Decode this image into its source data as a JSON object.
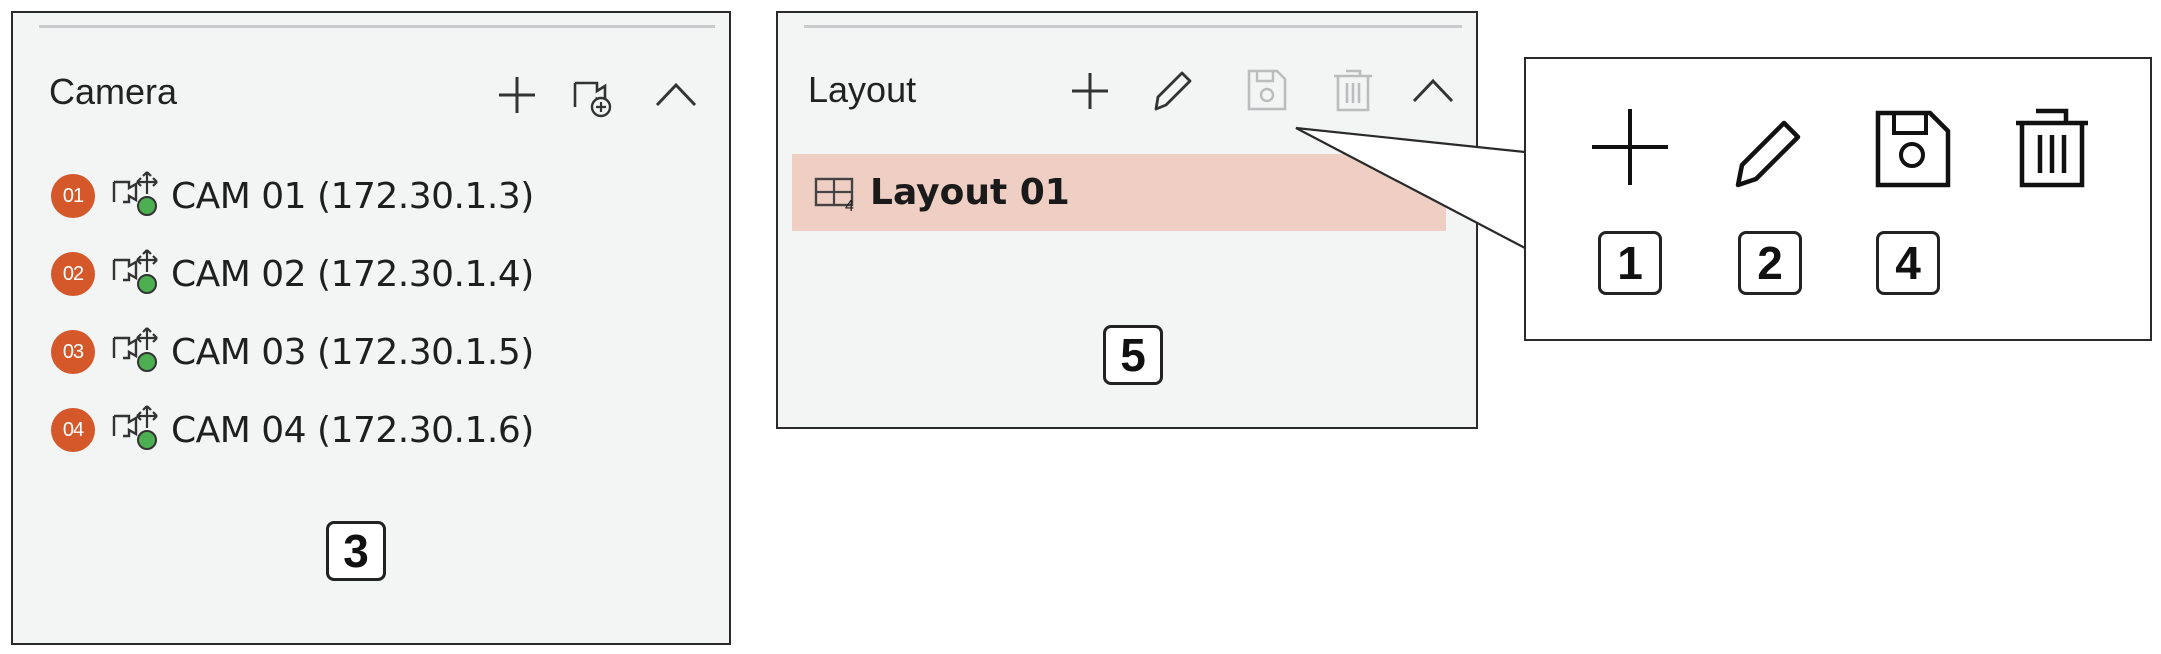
{
  "camera_panel": {
    "title": "Camera",
    "tools": {
      "add": "plus-icon",
      "register": "camera-add-icon",
      "collapse": "chevron-up-icon"
    },
    "cameras": [
      {
        "num": "01",
        "label": "CAM 01 (172.30.1.3)"
      },
      {
        "num": "02",
        "label": "CAM 02 (172.30.1.4)"
      },
      {
        "num": "03",
        "label": "CAM 03 (172.30.1.5)"
      },
      {
        "num": "04",
        "label": "CAM 04 (172.30.1.6)"
      }
    ],
    "marker": "3"
  },
  "layout_panel": {
    "title": "Layout",
    "tools": {
      "add": "plus-icon",
      "edit": "pencil-icon",
      "save": "save-icon",
      "delete": "trash-icon",
      "collapse": "chevron-up-icon"
    },
    "items": [
      {
        "label": "Layout 01",
        "icon": "layout-grid-icon"
      }
    ],
    "marker": "5"
  },
  "callout": {
    "icons": [
      "plus-icon",
      "pencil-icon",
      "save-icon",
      "trash-icon"
    ],
    "markers": [
      "1",
      "2",
      "4"
    ]
  },
  "colors": {
    "badge": "#d4582a",
    "status_green": "#4caf50",
    "selected_row": "#efcfc4",
    "panel_bg": "#f3f4f4",
    "disabled_icon": "#b9bdbd"
  }
}
